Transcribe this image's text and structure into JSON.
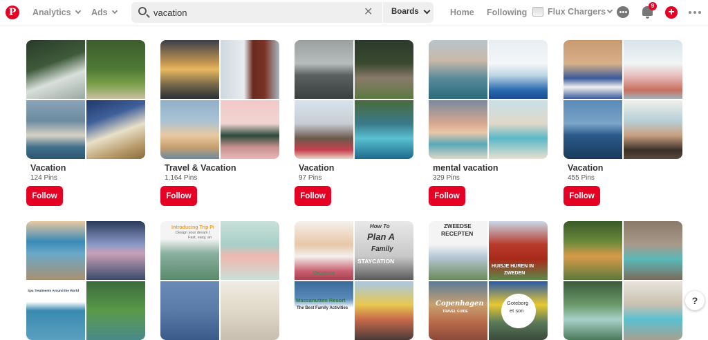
{
  "nav": {
    "logo": "P",
    "analytics_label": "Analytics",
    "ads_label": "Ads",
    "search_value": "vacation",
    "search_scope": "Boards",
    "home_label": "Home",
    "following_label": "Following",
    "profile_name": "Flux Chargers",
    "notification_count": "9",
    "accent_color": "#e60023"
  },
  "follow_label": "Follow",
  "boards_row1": [
    {
      "title": "Vacation",
      "count": "124 Pins"
    },
    {
      "title": "Travel & Vacation",
      "count": "1,164 Pins"
    },
    {
      "title": "Vacation",
      "count": "97 Pins"
    },
    {
      "title": "mental vacation",
      "count": "329 Pins"
    },
    {
      "title": "Vacation",
      "count": "455 Pins"
    }
  ],
  "tile_text": {
    "spa_title": "Spa Treatments Around the World",
    "trip_intro": "Introducing Trip Pi",
    "trip_sub1": "Design your dream t",
    "trip_sub2": "Fast, easy, an",
    "how_to": "How To",
    "plan_a": "Plan A",
    "family": "Family",
    "staycation": "STAYCATION",
    "vacations": "Vacations",
    "massanutten": "Massanutten Resort",
    "family_activities": "The Best Family Activities",
    "zweedse": "ZWEEDSE",
    "recepten": "RECEPTEN",
    "huisje": "HUISJE HUREN IN",
    "zweden": "ZWEDEN",
    "copenhagen": "Copenhagen",
    "travel_guide": "TRAVEL GUIDE",
    "goteborg": "Goteborg",
    "et_son": "et son"
  },
  "help_label": "?"
}
